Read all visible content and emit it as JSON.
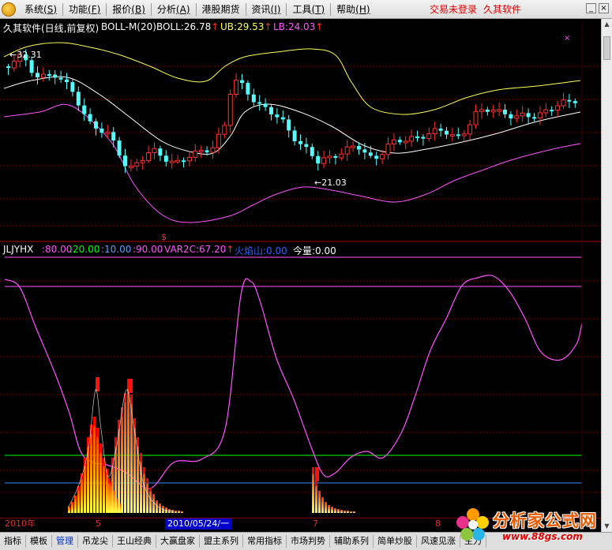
{
  "menu": {
    "items": [
      {
        "label": "系统",
        "hotkey": "(S)"
      },
      {
        "label": "功能",
        "hotkey": "(F)"
      },
      {
        "label": "报价",
        "hotkey": "(B)"
      },
      {
        "label": "分析",
        "hotkey": "(A)"
      },
      {
        "label": "港股期货",
        "hotkey": ""
      },
      {
        "label": "资讯",
        "hotkey": "(I)"
      },
      {
        "label": "工具",
        "hotkey": "(T)"
      },
      {
        "label": "帮助",
        "hotkey": "(H)"
      }
    ],
    "login_status": "交易未登录",
    "brand": "久其软件"
  },
  "upper_panel": {
    "title": "久其软件(日线,前复权)",
    "indicator": "BOLL-M(20)",
    "boll": {
      "label": "BOLL:",
      "value": "26.78"
    },
    "ub": {
      "label": "UB:",
      "value": "29.53"
    },
    "lb": {
      "label": "LB:",
      "value": "24.03"
    },
    "high_label": "32.31",
    "low_label": "21.03",
    "colors": {
      "up": "#ff3232",
      "down": "#54fcfc",
      "mid": "#ffffff",
      "ub": "#ffff54",
      "lb": "#ff54ff"
    }
  },
  "lower_panel": {
    "name": "JLJYHX",
    "params": [
      {
        "text": ":80.00",
        "color": "#ff54ff"
      },
      {
        "text": ":20.00",
        "color": "#00ff00"
      },
      {
        "text": ":10.00",
        "color": "#5aa0ff"
      },
      {
        "text": ":90.00",
        "color": "#ff54ff"
      },
      {
        "text": "VAR2C:67.20",
        "color": "#ff54ff"
      },
      {
        "text": "火焰山:0.00",
        "color": "#3060ff"
      },
      {
        "text": "今量:0.00",
        "color": "#ffffff"
      }
    ]
  },
  "date_axis": {
    "labels": [
      "2010年",
      "5",
      "7",
      "8"
    ],
    "cursor_date": "2010/05/24/一"
  },
  "tabs": [
    "指标",
    "模板",
    "管理",
    "吊龙尖",
    "王山经典",
    "大赢盘家",
    "盟主系列",
    "常用指标",
    "市场判势",
    "辅助系列",
    "简单炒股",
    "风速见涨",
    "主力"
  ],
  "active_tab": "管理",
  "watermark": {
    "title": "分析家公式网",
    "url": "www.88gs.com"
  }
}
